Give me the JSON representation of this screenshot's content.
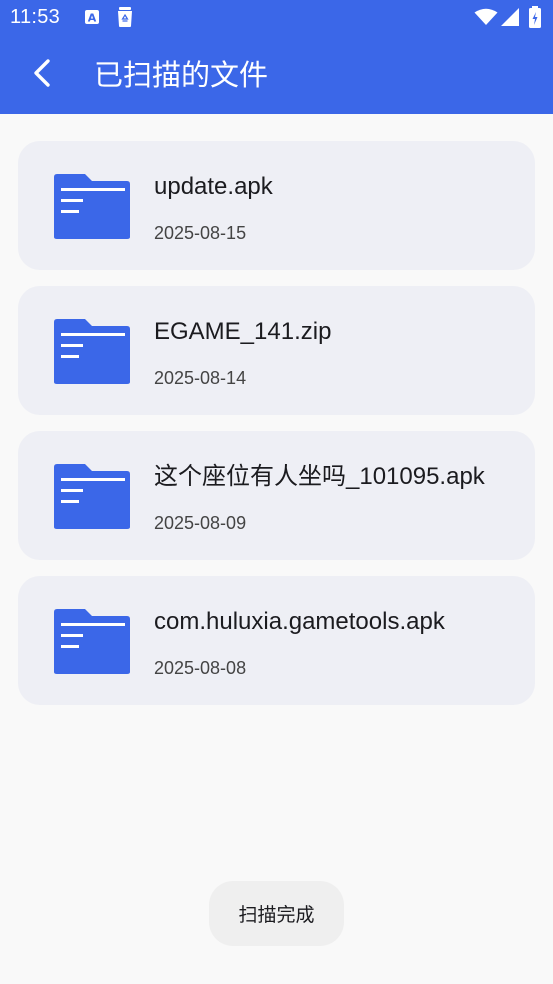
{
  "status_bar": {
    "time": "11:53",
    "notification_icons": [
      "font-a-icon",
      "trash-can-icon"
    ],
    "system_icons": [
      "wifi-icon",
      "cellular-signal-icon",
      "battery-icon"
    ]
  },
  "app_bar": {
    "back_icon": "chevron-left-icon",
    "title": "已扫描的文件",
    "background_color": "#3b67e8"
  },
  "files": [
    {
      "name": "update.apk",
      "date": "2025-08-15",
      "icon": "folder-icon"
    },
    {
      "name": "EGAME_141.zip",
      "date": "2025-08-14",
      "icon": "folder-icon"
    },
    {
      "name": "这个座位有人坐吗_101095.apk",
      "date": "2025-08-09",
      "icon": "folder-icon"
    },
    {
      "name": "com.huluxia.gametools.apk",
      "date": "2025-08-08",
      "icon": "folder-icon"
    }
  ],
  "colors": {
    "card_background": "#eeeff5",
    "folder_icon": "#3b67e8",
    "page_background": "#f9f9f9"
  },
  "toast": {
    "message": "扫描完成"
  }
}
